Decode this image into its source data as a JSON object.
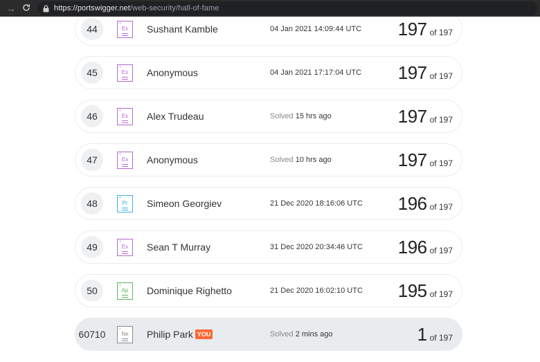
{
  "browser": {
    "url_host": "https://portswigger.net",
    "url_path": "/web-security/hall-of-fame"
  },
  "level_colors": {
    "Ex": "#b668cf",
    "Pr": "#3aaee8",
    "Ap": "#5cb85c",
    "Ne": "#8a8a8a"
  },
  "rows": [
    {
      "rank": "44",
      "level": "Ex",
      "name": "Sushant Kamble",
      "date": "04 Jan 2021 14:09:44 UTC",
      "solved_prefix": "",
      "score": "197",
      "total": "of 197"
    },
    {
      "rank": "45",
      "level": "Ex",
      "name": "Anonymous",
      "date": "04 Jan 2021 17:17:04 UTC",
      "solved_prefix": "",
      "score": "197",
      "total": "of 197"
    },
    {
      "rank": "46",
      "level": "Ex",
      "name": "Alex Trudeau",
      "date": "15 hrs ago",
      "solved_prefix": "Solved",
      "score": "197",
      "total": "of 197"
    },
    {
      "rank": "47",
      "level": "Ex",
      "name": "Anonymous",
      "date": "10 hrs ago",
      "solved_prefix": "Solved",
      "score": "197",
      "total": "of 197"
    },
    {
      "rank": "48",
      "level": "Pr",
      "name": "Simeon Georgiev",
      "date": "21 Dec 2020 18:16:06 UTC",
      "solved_prefix": "",
      "score": "196",
      "total": "of 197"
    },
    {
      "rank": "49",
      "level": "Ex",
      "name": "Sean T Murray",
      "date": "31 Dec 2020 20:34:46 UTC",
      "solved_prefix": "",
      "score": "196",
      "total": "of 197"
    },
    {
      "rank": "50",
      "level": "Ap",
      "name": "Dominique Righetto",
      "date": "21 Dec 2020 16:02:10 UTC",
      "solved_prefix": "",
      "score": "195",
      "total": "of 197"
    }
  ],
  "you_row": {
    "rank": "60710",
    "level": "Ne",
    "name": "Philip Park",
    "badge": "YOU",
    "date": "2 mins ago",
    "solved_prefix": "Solved",
    "score": "1",
    "total": "of 197"
  }
}
